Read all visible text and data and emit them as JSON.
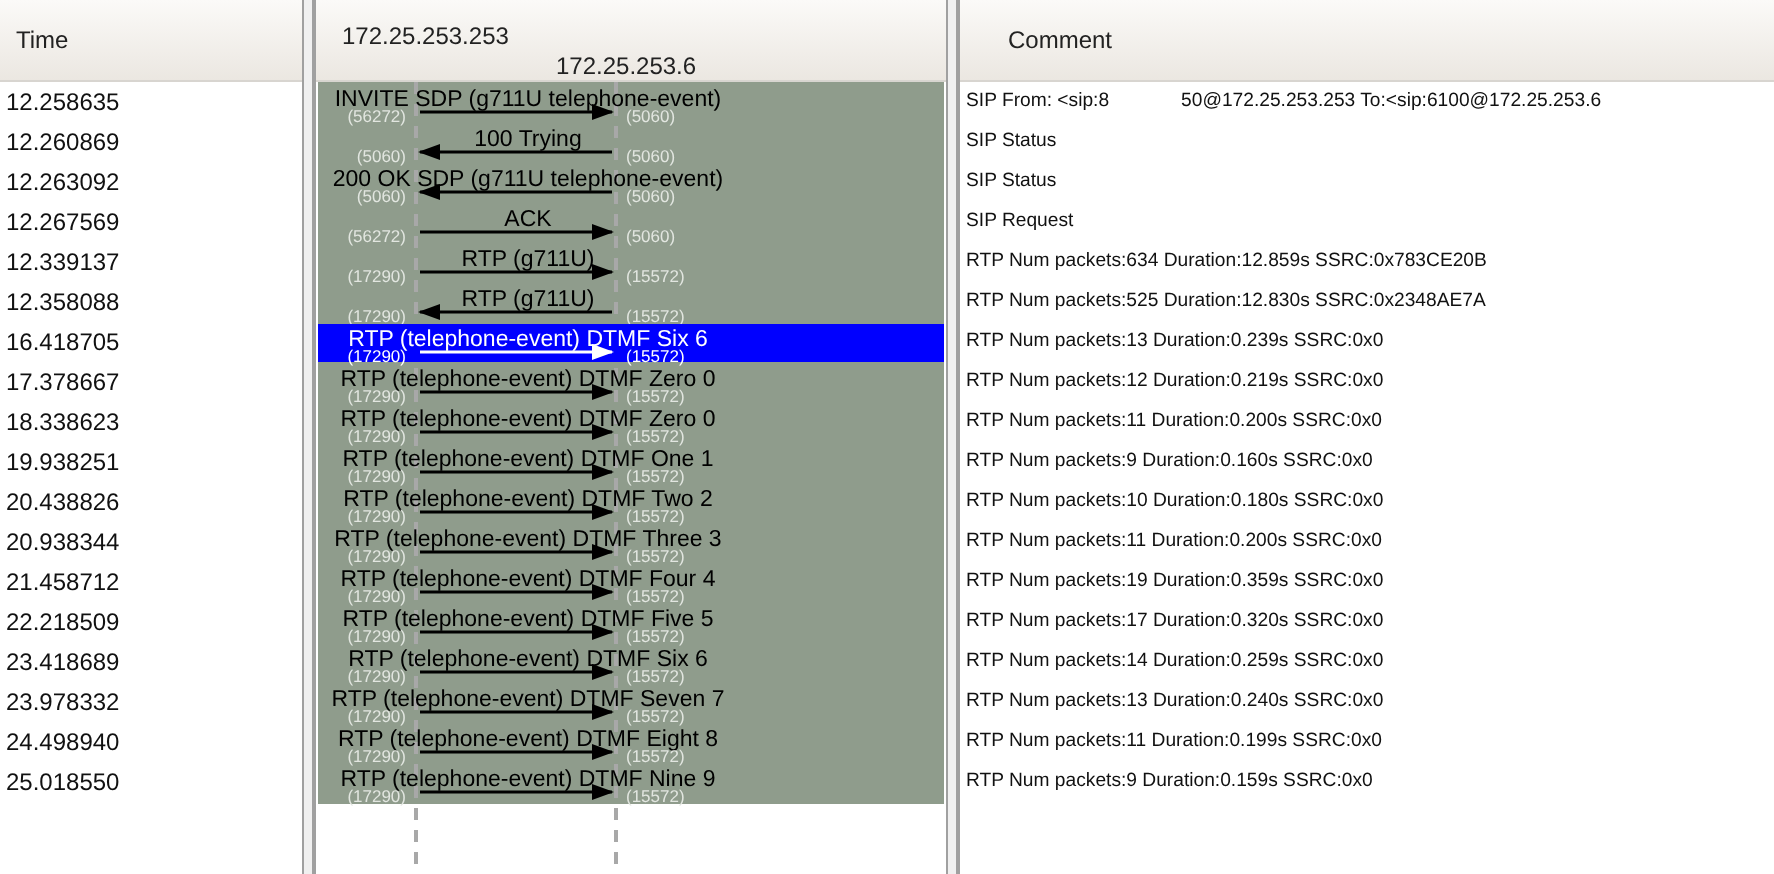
{
  "columns": {
    "time": "Time",
    "comment": "Comment"
  },
  "nodes": [
    "172.25.253.253",
    "172.25.253.6"
  ],
  "rows": [
    {
      "time": "12.258635",
      "label": "INVITE SDP (g711U telephone-event)",
      "towards_left": false,
      "left_port": "(56272)",
      "right_port": "(5060)",
      "comment": "SIP From: <sip:8",
      "comment_rest": "50@172.25.253.253 To:<sip:6100@172.25.253.6",
      "selected": false
    },
    {
      "time": "12.260869",
      "label": "100 Trying",
      "towards_left": true,
      "left_port": "(5060)",
      "right_port": "(5060)",
      "comment": "SIP Status",
      "selected": false
    },
    {
      "time": "12.263092",
      "label": "200 OK SDP (g711U telephone-event)",
      "towards_left": true,
      "left_port": "(5060)",
      "right_port": "(5060)",
      "comment": "SIP Status",
      "selected": false
    },
    {
      "time": "12.267569",
      "label": "ACK",
      "towards_left": false,
      "left_port": "(56272)",
      "right_port": "(5060)",
      "comment": "SIP Request",
      "selected": false
    },
    {
      "time": "12.339137",
      "label": "RTP (g711U)",
      "towards_left": false,
      "left_port": "(17290)",
      "right_port": "(15572)",
      "comment": "RTP Num packets:634  Duration:12.859s SSRC:0x783CE20B",
      "selected": false
    },
    {
      "time": "12.358088",
      "label": "RTP (g711U)",
      "towards_left": true,
      "left_port": "(17290)",
      "right_port": "(15572)",
      "comment": "RTP Num packets:525  Duration:12.830s SSRC:0x2348AE7A",
      "selected": false
    },
    {
      "time": "16.418705",
      "label": "RTP (telephone-event) DTMF Six 6",
      "towards_left": false,
      "left_port": "(17290)",
      "right_port": "(15572)",
      "comment": "RTP Num packets:13  Duration:0.239s SSRC:0x0",
      "selected": true
    },
    {
      "time": "17.378667",
      "label": "RTP (telephone-event) DTMF Zero 0",
      "towards_left": false,
      "left_port": "(17290)",
      "right_port": "(15572)",
      "comment": "RTP Num packets:12  Duration:0.219s SSRC:0x0",
      "selected": false
    },
    {
      "time": "18.338623",
      "label": "RTP (telephone-event) DTMF Zero 0",
      "towards_left": false,
      "left_port": "(17290)",
      "right_port": "(15572)",
      "comment": "RTP Num packets:11  Duration:0.200s SSRC:0x0",
      "selected": false
    },
    {
      "time": "19.938251",
      "label": "RTP (telephone-event) DTMF One 1",
      "towards_left": false,
      "left_port": "(17290)",
      "right_port": "(15572)",
      "comment": "RTP Num packets:9  Duration:0.160s SSRC:0x0",
      "selected": false
    },
    {
      "time": "20.438826",
      "label": "RTP (telephone-event) DTMF Two 2",
      "towards_left": false,
      "left_port": "(17290)",
      "right_port": "(15572)",
      "comment": "RTP Num packets:10  Duration:0.180s SSRC:0x0",
      "selected": false
    },
    {
      "time": "20.938344",
      "label": "RTP (telephone-event) DTMF Three 3",
      "towards_left": false,
      "left_port": "(17290)",
      "right_port": "(15572)",
      "comment": "RTP Num packets:11  Duration:0.200s SSRC:0x0",
      "selected": false
    },
    {
      "time": "21.458712",
      "label": "RTP (telephone-event) DTMF Four 4",
      "towards_left": false,
      "left_port": "(17290)",
      "right_port": "(15572)",
      "comment": "RTP Num packets:19  Duration:0.359s SSRC:0x0",
      "selected": false
    },
    {
      "time": "22.218509",
      "label": "RTP (telephone-event) DTMF Five 5",
      "towards_left": false,
      "left_port": "(17290)",
      "right_port": "(15572)",
      "comment": "RTP Num packets:17  Duration:0.320s SSRC:0x0",
      "selected": false
    },
    {
      "time": "23.418689",
      "label": "RTP (telephone-event) DTMF Six 6",
      "towards_left": false,
      "left_port": "(17290)",
      "right_port": "(15572)",
      "comment": "RTP Num packets:14  Duration:0.259s SSRC:0x0",
      "selected": false
    },
    {
      "time": "23.978332",
      "label": "RTP (telephone-event) DTMF Seven 7",
      "towards_left": false,
      "left_port": "(17290)",
      "right_port": "(15572)",
      "comment": "RTP Num packets:13  Duration:0.240s SSRC:0x0",
      "selected": false
    },
    {
      "time": "24.498940",
      "label": "RTP (telephone-event) DTMF Eight 8",
      "towards_left": false,
      "left_port": "(17290)",
      "right_port": "(15572)",
      "comment": "RTP Num packets:11  Duration:0.199s SSRC:0x0",
      "selected": false
    },
    {
      "time": "25.018550",
      "label": "RTP (telephone-event) DTMF Nine 9",
      "towards_left": false,
      "left_port": "(17290)",
      "right_port": "(15572)",
      "comment": "RTP Num packets:9  Duration:0.159s SSRC:0x0",
      "selected": false
    }
  ]
}
